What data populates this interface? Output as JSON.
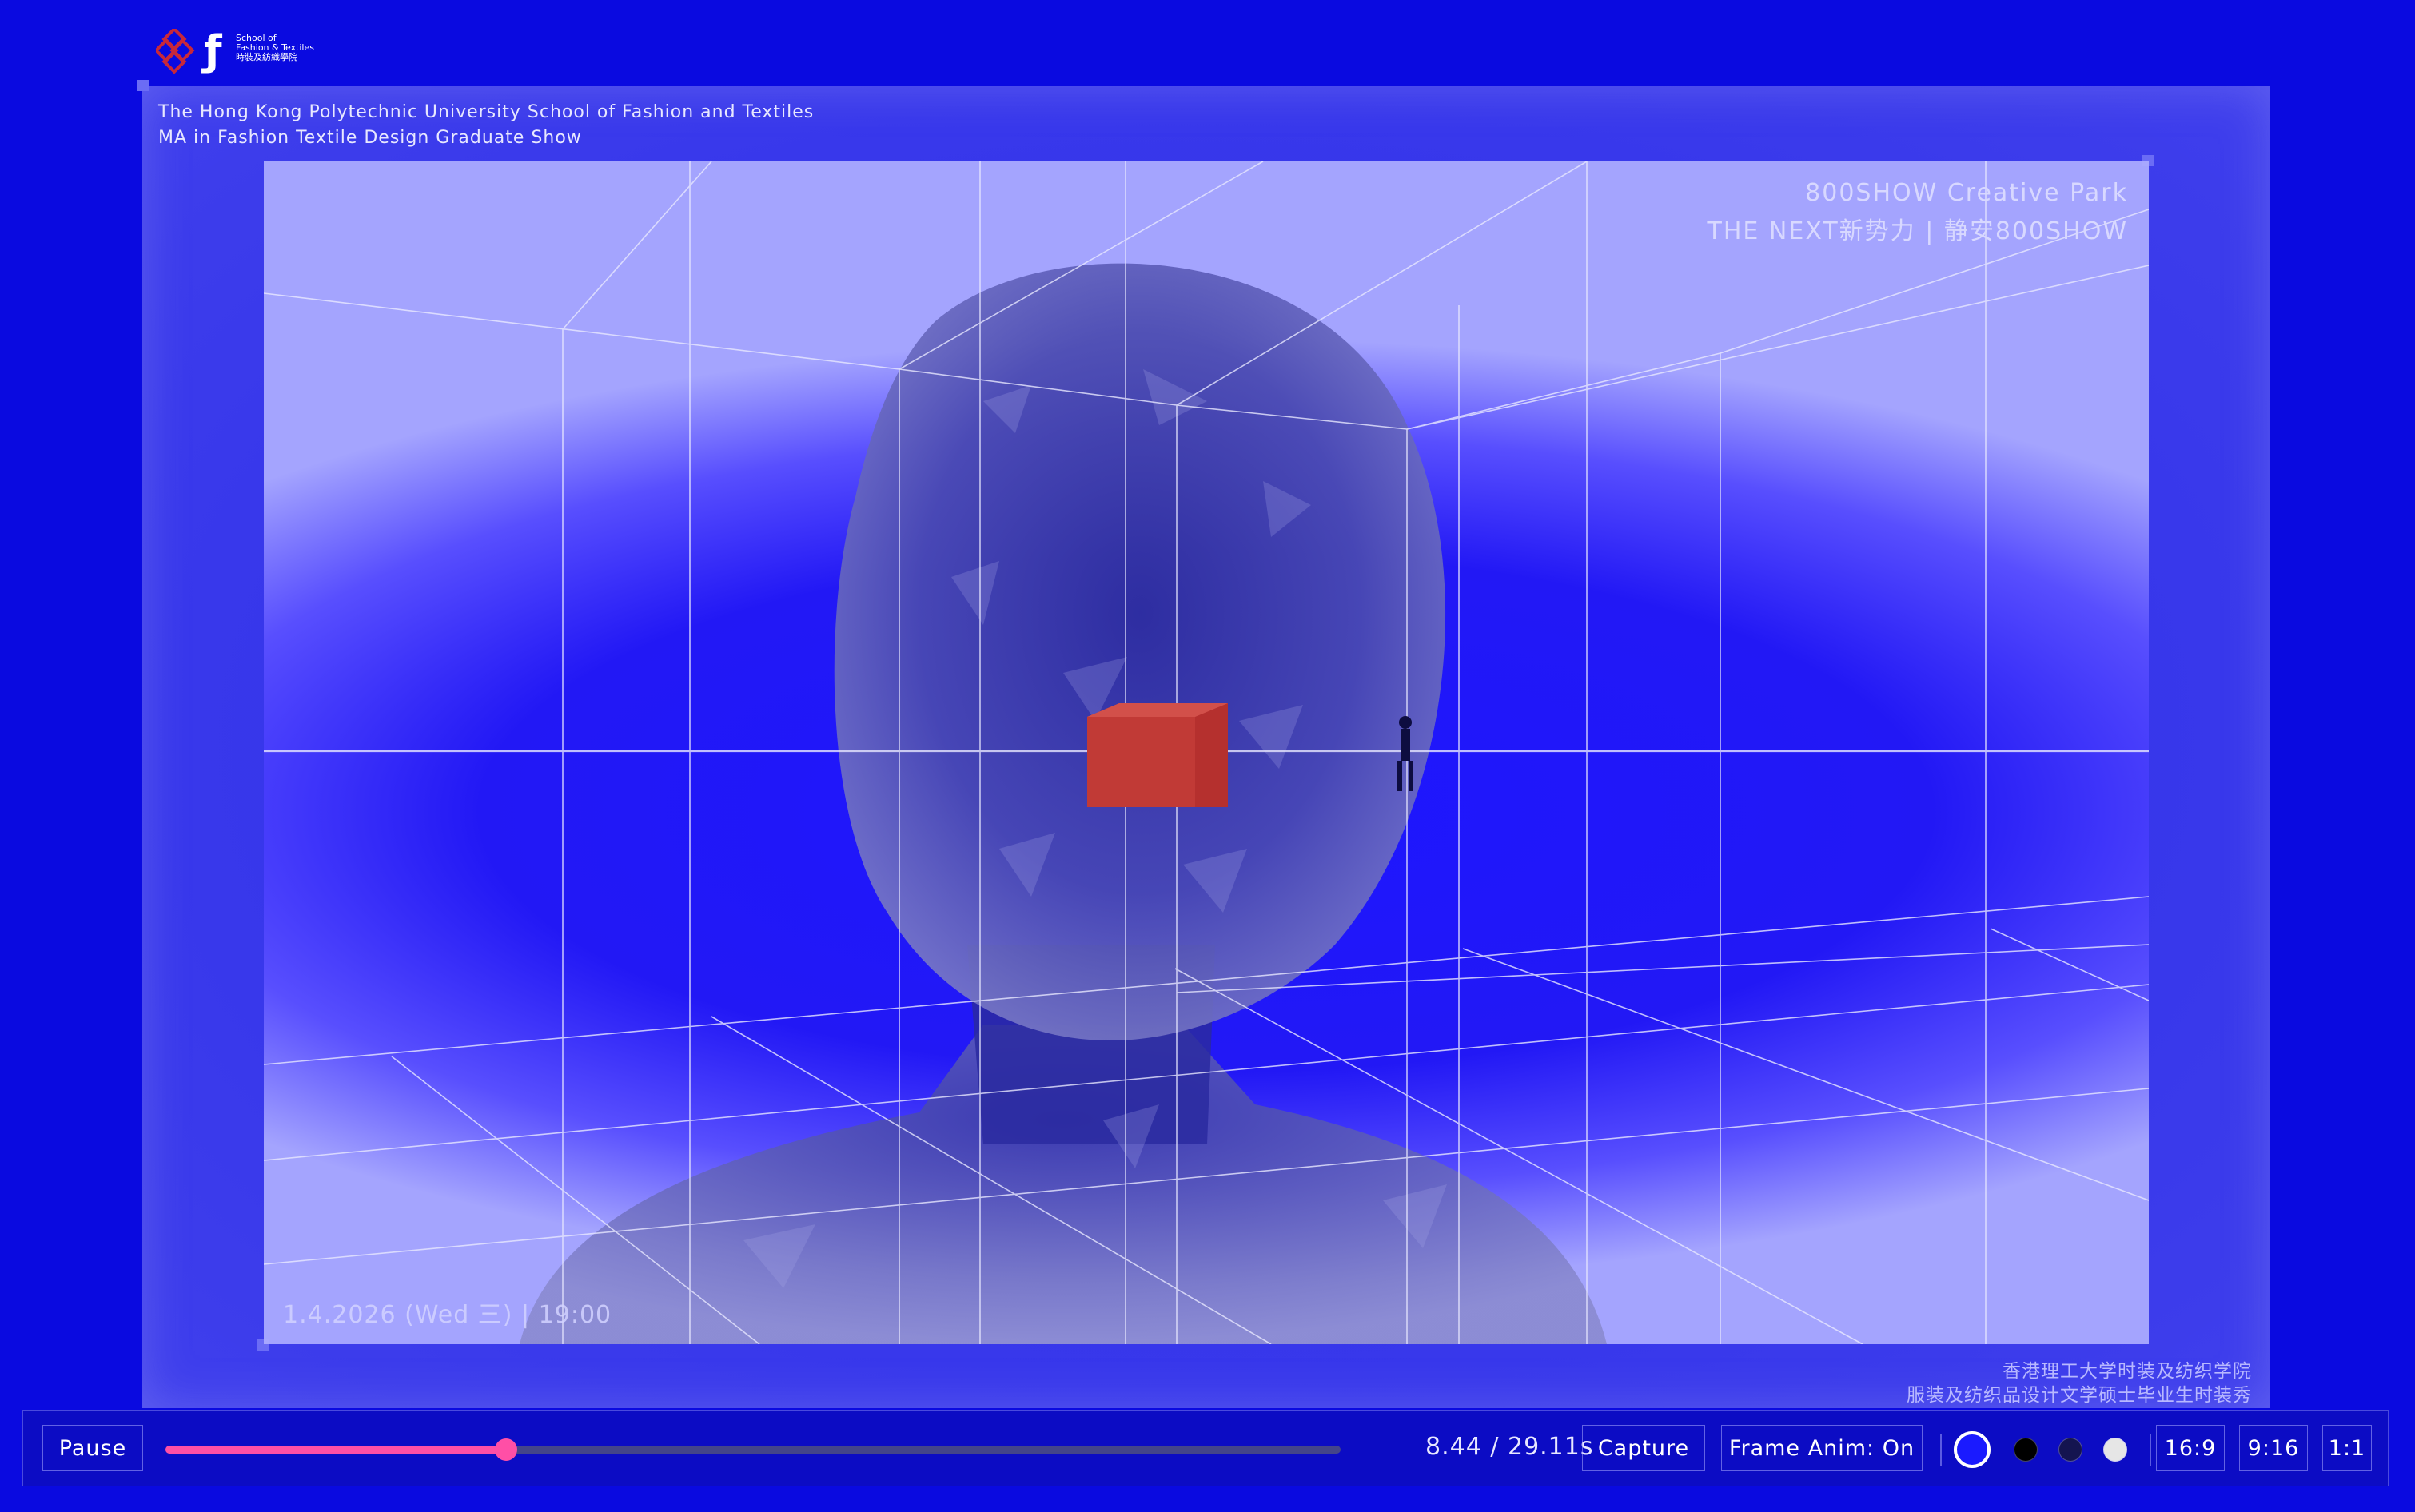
{
  "logo": {
    "icon": "polyu-lattice-logo",
    "text_lines": [
      "School of",
      "Fashion & Textiles",
      "時裝及紡織學院"
    ]
  },
  "header": {
    "line1": "The Hong Kong Polytechnic University School of Fashion and Textiles",
    "line2": "MA in Fashion Textile Design Graduate Show"
  },
  "venue": {
    "line1": "800SHOW Creative Park",
    "line2": "THE NEXT新势力 | 静安800SHOW"
  },
  "event": {
    "date": "1.4.2026 (Wed 三) | 19:00"
  },
  "credit_cn": {
    "line1": "香港理工大学时装及纺织学院",
    "line2": "服装及纺织品设计文学硕士毕业生时装秀"
  },
  "player": {
    "pause_label": "Pause",
    "progress_fraction": 0.29,
    "time_display": "8.44 / 29.11s",
    "capture_label": "Capture",
    "frame_anim_label": "Frame Anim: On",
    "themes": [
      {
        "name": "blue",
        "color": "#1a1aff",
        "selected": true
      },
      {
        "name": "black",
        "color": "#000000",
        "selected": false
      },
      {
        "name": "navy",
        "color": "#141450",
        "selected": false
      },
      {
        "name": "white",
        "color": "#e6e6e6",
        "selected": false
      }
    ],
    "ratios": [
      "16:9",
      "9:16",
      "1:1"
    ]
  },
  "colors": {
    "background": "#0a0ae0",
    "accent": "#ff4fa6",
    "cube": "#b5302e"
  }
}
